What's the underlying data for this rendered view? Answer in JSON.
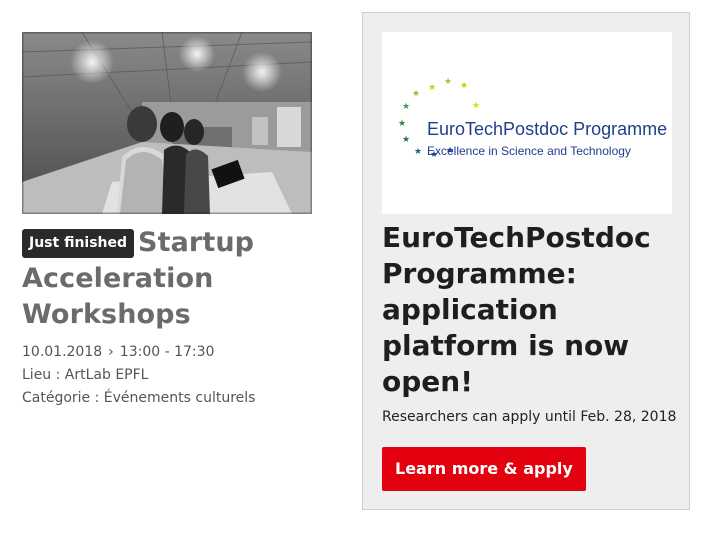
{
  "event": {
    "badge": "Just finished",
    "title": "Startup Acceleration Workshops",
    "date": "10.01.2018",
    "separator": "›",
    "time": "13:00 - 17:30",
    "location": "Lieu : ArtLab EPFL",
    "category": "Catégorie : Événements culturels"
  },
  "news": {
    "logo": {
      "name_part1": "EuroTech",
      "name_part2": "Postdoc Programme",
      "tagline": "Excellence in Science and Technology"
    },
    "title": "EuroTechPostdoc Programme: application platform is now open!",
    "description": "Researchers can apply until Feb. 28, 2018",
    "cta_label": "Learn more & apply",
    "cta_color": "#e3000f"
  }
}
